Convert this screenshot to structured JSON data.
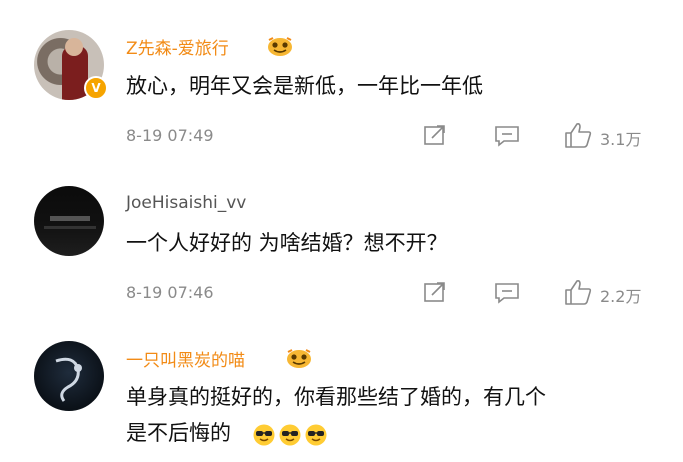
{
  "comments": [
    {
      "username": "Z先森-爱旅行",
      "content": "放心，明年又会是新低，一年比一年低",
      "time": "8-19 07:49",
      "likes": "3.1万",
      "name_color": "#f28b16",
      "badge": "V"
    },
    {
      "username": "JoeHisaishi_vv",
      "content": "一个人好好的 为啥结婚？想不开？",
      "time": "8-19 07:46",
      "likes": "2.2万",
      "name_color": "#555555"
    },
    {
      "username": "一只叫黑炭的喵",
      "content_line1": "单身真的挺好的，你看那些结了婚的，有几个",
      "content_line2": "是不后悔的",
      "name_color": "#f28b16"
    }
  ]
}
